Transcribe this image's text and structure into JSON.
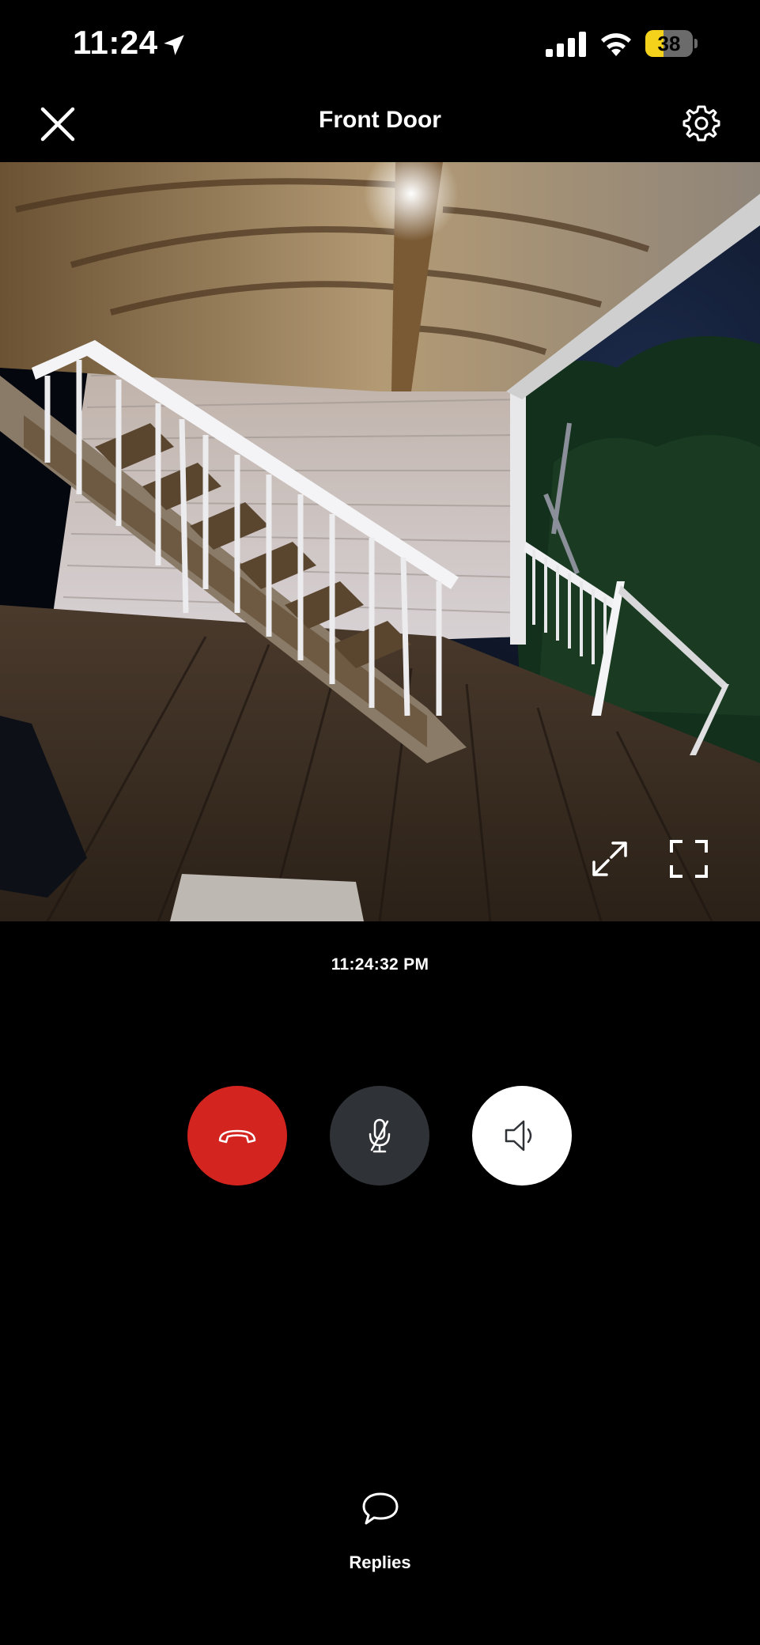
{
  "status_bar": {
    "time": "11:24",
    "battery_level": "38",
    "battery_fraction": 0.38,
    "icons": [
      "location-arrow-icon",
      "signal-icon",
      "wifi-icon",
      "battery-icon"
    ]
  },
  "header": {
    "title": "Front Door",
    "close_icon": "close-icon",
    "settings_icon": "gear-icon"
  },
  "video": {
    "controls": [
      "expand-icon",
      "fullscreen-icon"
    ]
  },
  "timestamp": "11:24:32 PM",
  "call_controls": {
    "hangup_icon": "phone-hangup-icon",
    "mute_icon": "microphone-muted-icon",
    "speaker_icon": "speaker-icon",
    "colors": {
      "hangup": "#d42420",
      "mute": "#2f3236",
      "speaker": "#ffffff"
    }
  },
  "replies": {
    "label": "Replies",
    "icon": "chat-bubble-icon"
  }
}
